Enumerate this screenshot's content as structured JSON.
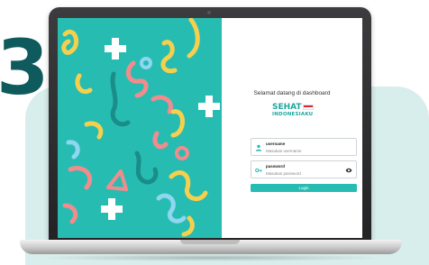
{
  "step": {
    "number": "3"
  },
  "login": {
    "welcome_text": "Selamat datang di dashboard",
    "logo_line1": "SEHAT",
    "logo_line2": "INDONESIAKU",
    "username_label": "username",
    "username_placeholder": "Masukan username",
    "password_label": "password",
    "password_placeholder": "Masukan password",
    "login_button": "Login"
  },
  "colors": {
    "accent": "#27bcb2",
    "step_number": "#0f5a5c",
    "background_blob": "#d8eeec",
    "flag_red": "#e5262d"
  },
  "icons": {
    "username": "user-icon",
    "password": "key-icon",
    "toggle_password": "eye-icon"
  }
}
